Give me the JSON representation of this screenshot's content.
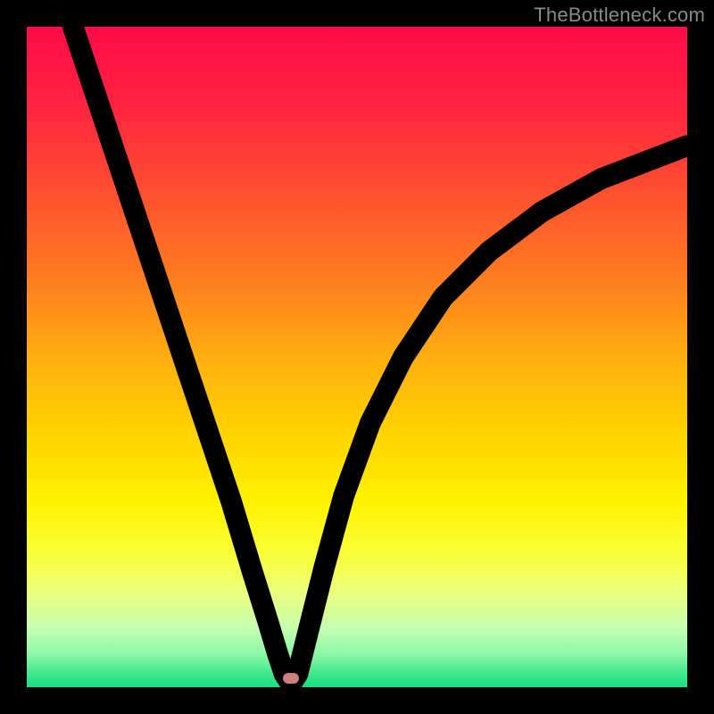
{
  "watermark": "TheBottleneck.com",
  "marker_color": "#cc7f7c",
  "chart_data": {
    "type": "line",
    "title": "",
    "xlabel": "",
    "ylabel": "",
    "xlim": [
      0,
      100
    ],
    "ylim": [
      0,
      100
    ],
    "curve_points": [
      {
        "x": 7,
        "y": 100
      },
      {
        "x": 11,
        "y": 88
      },
      {
        "x": 15,
        "y": 76
      },
      {
        "x": 19,
        "y": 64
      },
      {
        "x": 23,
        "y": 52
      },
      {
        "x": 27,
        "y": 40
      },
      {
        "x": 31,
        "y": 28
      },
      {
        "x": 34,
        "y": 18
      },
      {
        "x": 36.5,
        "y": 10
      },
      {
        "x": 38,
        "y": 5
      },
      {
        "x": 39,
        "y": 2
      },
      {
        "x": 40,
        "y": 0.5
      },
      {
        "x": 41,
        "y": 2
      },
      {
        "x": 42.5,
        "y": 8
      },
      {
        "x": 45,
        "y": 18
      },
      {
        "x": 48,
        "y": 29
      },
      {
        "x": 52,
        "y": 40
      },
      {
        "x": 57,
        "y": 50
      },
      {
        "x": 63,
        "y": 59
      },
      {
        "x": 70,
        "y": 66
      },
      {
        "x": 78,
        "y": 72
      },
      {
        "x": 87,
        "y": 77
      },
      {
        "x": 100,
        "y": 82
      }
    ],
    "marker": {
      "x": 40,
      "y": 1.3
    },
    "gradient_stops": [
      {
        "offset": 0,
        "color": "#ff0b49"
      },
      {
        "offset": 12,
        "color": "#ff2440"
      },
      {
        "offset": 25,
        "color": "#ff4f30"
      },
      {
        "offset": 38,
        "color": "#ff7c20"
      },
      {
        "offset": 50,
        "color": "#ffae10"
      },
      {
        "offset": 62,
        "color": "#ffd400"
      },
      {
        "offset": 72,
        "color": "#fff200"
      },
      {
        "offset": 80,
        "color": "#faff3a"
      },
      {
        "offset": 86,
        "color": "#eaff80"
      },
      {
        "offset": 91,
        "color": "#c6ffb0"
      },
      {
        "offset": 95,
        "color": "#8cf7a6"
      },
      {
        "offset": 98,
        "color": "#3fe88e"
      },
      {
        "offset": 100,
        "color": "#18df7f"
      }
    ]
  }
}
